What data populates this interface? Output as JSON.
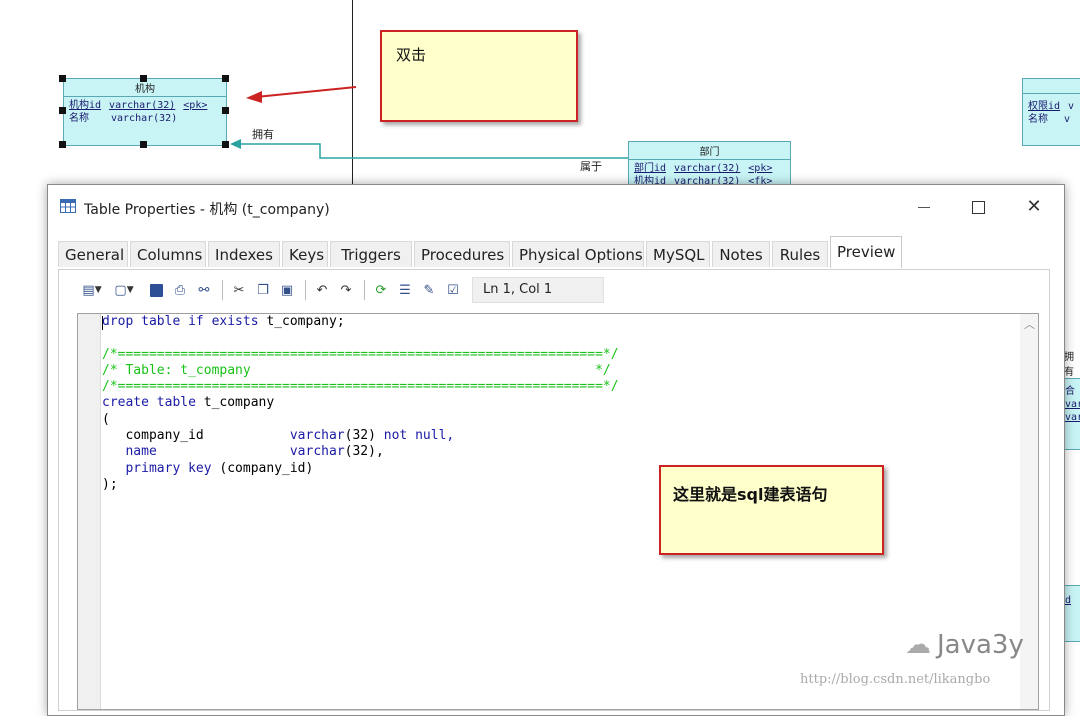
{
  "diagram": {
    "entity_org": {
      "name": "机构",
      "rows": [
        {
          "col": "机构id",
          "type": "varchar(32)",
          "key": "<pk>"
        },
        {
          "col": "名称",
          "type": "varchar(32)",
          "key": ""
        }
      ]
    },
    "entity_dept": {
      "name": "部门",
      "rows": [
        {
          "col": "部门id",
          "type": "varchar(32)",
          "key": "<pk>"
        },
        {
          "col": "机构id",
          "type": "varchar(32)",
          "key": "<fk>"
        }
      ]
    },
    "entity_right": {
      "rows": [
        {
          "col": "权限id",
          "type": "v"
        },
        {
          "col": "名称",
          "type": "v"
        }
      ]
    },
    "rel_label_own": "拥有",
    "rel_label_belong": "属于",
    "right_edge_frag": [
      "拥有",
      "合",
      "var",
      "var",
      "d"
    ],
    "note_dblclick": "双击",
    "note_sql": "这里就是sql建表语句"
  },
  "dialog": {
    "title": "Table Properties - 机构 (t_company)",
    "tabs": [
      "General",
      "Columns",
      "Indexes",
      "Keys",
      "Triggers",
      "Procedures",
      "Physical Options",
      "MySQL",
      "Notes",
      "Rules",
      "Preview"
    ],
    "active_tab": "Preview",
    "status_position": "Ln 1, Col 1",
    "code": {
      "l1": [
        "drop table if exists",
        "t_company;"
      ],
      "c1": "/*==============================================================*/",
      "c2": "/* Table: t_company                                            */",
      "c3": "/*==============================================================*/",
      "l5": [
        "create table",
        "t_company"
      ],
      "l6": "(",
      "l7": [
        "   company_id",
        "varchar",
        "(32)",
        "not null,"
      ],
      "l8": [
        "   name",
        "varchar",
        "(32),"
      ],
      "l9": [
        "   primary key",
        "(company_id)"
      ],
      "l10": ");"
    }
  },
  "watermark": {
    "brand": "Java3y",
    "url": "http://blog.csdn.net/likangbo"
  },
  "colors": {
    "entity_fill": "#c8f4f6",
    "note_fill": "#ffffcc",
    "note_border": "#cc2222",
    "keyword": "#1a1aa6",
    "comment": "#19c219"
  }
}
